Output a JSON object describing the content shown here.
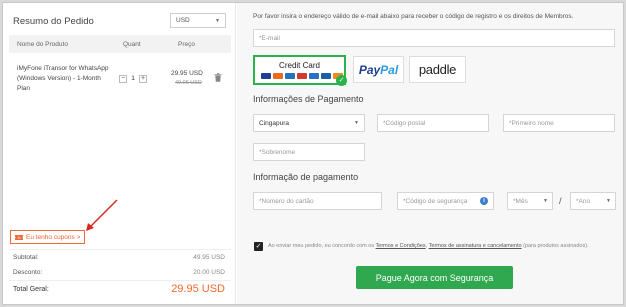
{
  "order": {
    "title": "Resumo do Pedido",
    "currency": "USD",
    "columns": {
      "name": "Nome do Produto",
      "qty": "Quant",
      "price": "Preço"
    },
    "product": {
      "name": "iMyFone iTransor for WhatsApp (Windows Version) - 1-Month Plan",
      "quantity": "1",
      "minus": "−",
      "plus": "+",
      "price": "29.95 USD",
      "old_price": "49.95 USD"
    },
    "coupon_label": "Eu tenho cupons >",
    "subtotal_label": "Subtotal:",
    "subtotal_value": "49.95 USD",
    "discount_label": "Desconto:",
    "discount_value": "20.00 USD",
    "total_label": "Total Geral:",
    "total_value": "29.95 USD"
  },
  "checkout": {
    "notice": "Por favor insira o endereço válido de e-mail abaixo para receber o código de registro e os direitos de Membros.",
    "email_placeholder": "*E-mail",
    "methods": {
      "credit_card": "Credit Card",
      "paypal_a": "Pay",
      "paypal_b": "Pal",
      "paddle": "paddle"
    },
    "payment_info_title": "Informações de Pagamento",
    "country": "Cingapura",
    "postal_placeholder": "*Código postal",
    "first_name_placeholder": "*Primeiro nome",
    "last_name_placeholder": "*Sobrenome",
    "card_info_title": "Informação de pagamento",
    "card_number_placeholder": "*Número do cartão",
    "security_code_placeholder": "*Código de segurança",
    "month_placeholder": "*Mês",
    "slash": "/",
    "year_placeholder": "*Ano",
    "agree": {
      "prefix": "Ao enviar meu pedido, eu concordo com os ",
      "terms": "Termos e Condições",
      "sep": ", ",
      "subscription": "Termos de assinatura e cancelamento",
      "suffix": " (para produtos assinados)."
    },
    "pay_button": "Pague Agora com Segurança"
  },
  "colors": {
    "accent_green": "#2fa84f",
    "accent_orange": "#f06a2c",
    "annotation_red": "#d9261c"
  }
}
